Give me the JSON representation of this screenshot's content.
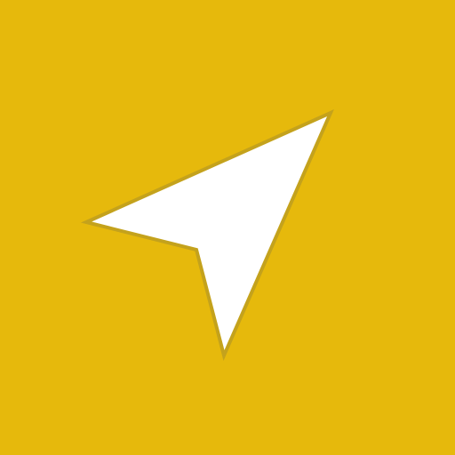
{
  "icon": {
    "name": "navigation-arrow-icon",
    "colors": {
      "background": "#E6B90C",
      "arrow_fill": "#FFFFFF",
      "arrow_outline": "#C4A21C"
    }
  }
}
